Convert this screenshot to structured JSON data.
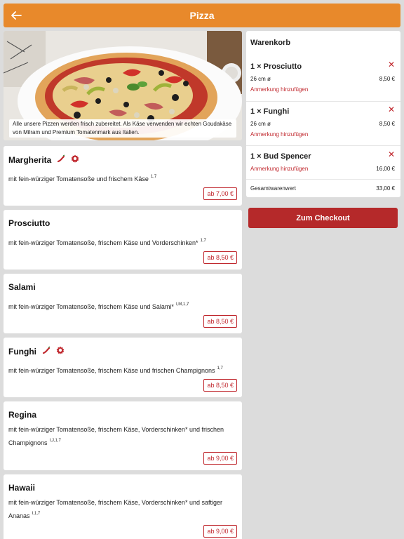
{
  "header": {
    "title": "Pizza",
    "back_icon": "arrow-left-icon"
  },
  "hero": {
    "caption": "Alle unsere Pizzen werden frisch zubereitet. Als Käse verwenden wir echten Goudakäse von Milram und Premium Tomatenmark aus Italien."
  },
  "products": [
    {
      "name": "Margherita",
      "desc": "mit fein-würziger Tomatensoße und frischem Käse",
      "allergens": "1,7",
      "price": "ab 7,00 €",
      "icons": [
        "chili-icon",
        "veggie-badge-icon"
      ]
    },
    {
      "name": "Prosciutto",
      "desc": "mit fein-würziger Tomatensoße, frischem Käse und Vorderschinken*",
      "allergens": "1,7",
      "price": "ab 8,50 €",
      "icons": []
    },
    {
      "name": "Salami",
      "desc": "mit fein-würziger Tomatensoße, frischem Käse und Salami*",
      "allergens": "I,M,1,7",
      "price": "ab 8,50 €",
      "icons": []
    },
    {
      "name": "Funghi",
      "desc": "mit fein-würziger Tomatensoße, frischem Käse und frischen Champignons",
      "allergens": "1,7",
      "price": "ab 8,50 €",
      "icons": [
        "chili-icon",
        "veggie-badge-icon"
      ]
    },
    {
      "name": "Regina",
      "desc": "mit fein-würziger Tomatensoße, frischem Käse, Vorderschinken* und frischen Champignons",
      "allergens": "I,J,1,7",
      "price": "ab 9,00 €",
      "icons": []
    },
    {
      "name": "Hawaii",
      "desc": "mit fein-würziger Tomatensoße, frischem Käse, Vorderschinken* und saftiger Ananas",
      "allergens": "I,1,7",
      "price": "ab 9,00 €",
      "icons": []
    }
  ],
  "cart": {
    "title": "Warenkorb",
    "items": [
      {
        "name": "1 × Prosciutto",
        "size": "26 cm ø",
        "price": "8,50 €",
        "note": "Anmerkung hinzufügen"
      },
      {
        "name": "1 × Funghi",
        "size": "26 cm ø",
        "price": "8,50 €",
        "note": "Anmerkung hinzufügen"
      },
      {
        "name": "1 × Bud Spencer",
        "size": "",
        "price": "16,00 €",
        "note": "Anmerkung hinzufügen"
      }
    ],
    "remove_symbol": "✕",
    "total_label": "Gesamtwarenwert",
    "total_value": "33,00 €"
  },
  "checkout": {
    "label": "Zum Checkout"
  },
  "colors": {
    "header": "#e8892b",
    "accent": "#c0272d",
    "checkout": "#b5292a",
    "background": "#dcdcdc"
  }
}
